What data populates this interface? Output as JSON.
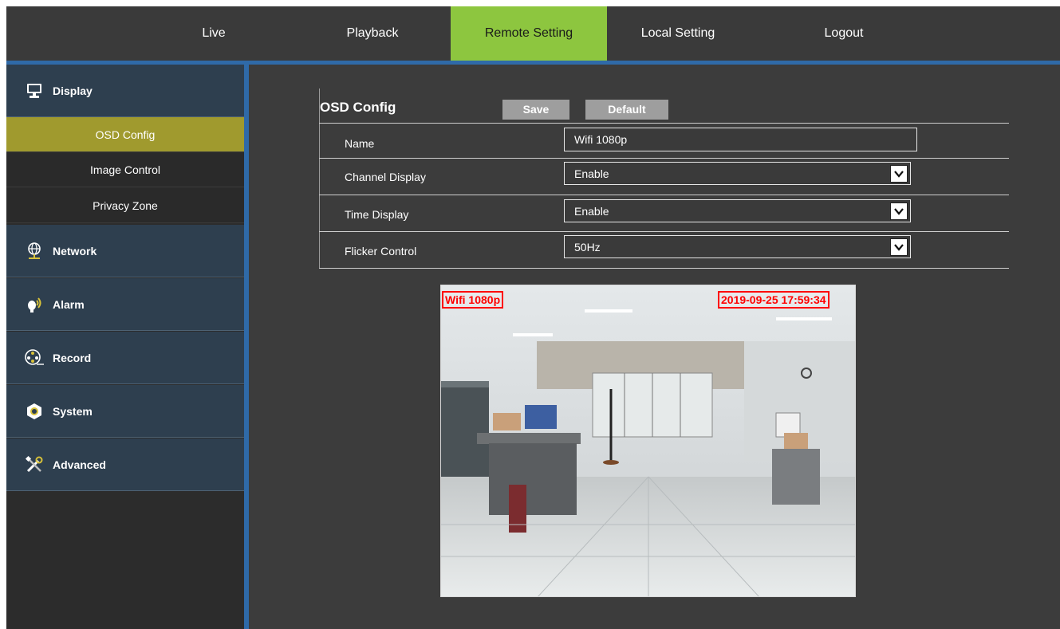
{
  "nav": {
    "items": [
      {
        "label": "Live",
        "active": false
      },
      {
        "label": "Playback",
        "active": false
      },
      {
        "label": "Remote Setting",
        "active": true
      },
      {
        "label": "Local Setting",
        "active": false
      },
      {
        "label": "Logout",
        "active": false
      }
    ],
    "accent_color": "#8dc63f",
    "divider_color": "#2f6aa8"
  },
  "sidebar": {
    "sections": [
      {
        "label": "Display",
        "icon": "monitor-icon",
        "expanded": true,
        "items": [
          {
            "label": "OSD Config",
            "active": true
          },
          {
            "label": "Image Control",
            "active": false
          },
          {
            "label": "Privacy Zone",
            "active": false
          }
        ]
      },
      {
        "label": "Network",
        "icon": "globe-network-icon"
      },
      {
        "label": "Alarm",
        "icon": "alarm-signal-icon"
      },
      {
        "label": "Record",
        "icon": "film-reel-icon"
      },
      {
        "label": "System",
        "icon": "hex-nut-icon"
      },
      {
        "label": "Advanced",
        "icon": "tools-icon"
      }
    ],
    "active_color": "#a09a2e"
  },
  "osd": {
    "title": "OSD Config",
    "save_label": "Save",
    "default_label": "Default",
    "rows": [
      {
        "label": "Name",
        "value": "Wifi 1080p",
        "type": "text"
      },
      {
        "label": "Channel Display",
        "value": "Enable",
        "type": "select"
      },
      {
        "label": "Time Display",
        "value": "Enable",
        "type": "select"
      },
      {
        "label": "Flicker Control",
        "value": "50Hz",
        "type": "select"
      }
    ]
  },
  "preview": {
    "channel_overlay": "Wifi 1080p",
    "time_overlay": "2019-09-25 17:59:34",
    "overlay_color": "#ff0000"
  }
}
